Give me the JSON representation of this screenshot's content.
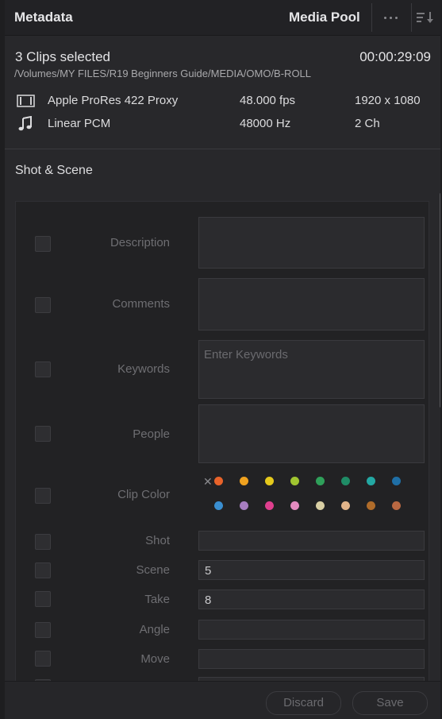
{
  "header": {
    "title": "Metadata",
    "media_pool": "Media Pool"
  },
  "clip_info": {
    "selected": "3 Clips selected",
    "timecode": "00:00:29:09",
    "path": "/Volumes/MY FILES/R19 Beginners Guide/MEDIA/OMO/B-ROLL",
    "video": {
      "codec": "Apple ProRes 422 Proxy",
      "fps": "48.000 fps",
      "resolution": "1920 x 1080"
    },
    "audio": {
      "codec": "Linear PCM",
      "rate": "48000 Hz",
      "channels": "2 Ch"
    }
  },
  "section": {
    "title": "Shot & Scene"
  },
  "fields": {
    "description": {
      "label": "Description",
      "value": ""
    },
    "comments": {
      "label": "Comments",
      "value": ""
    },
    "keywords": {
      "label": "Keywords",
      "placeholder": "Enter Keywords"
    },
    "people": {
      "label": "People",
      "value": ""
    },
    "clip_color": {
      "label": "Clip Color"
    },
    "shot": {
      "label": "Shot",
      "value": ""
    },
    "scene": {
      "label": "Scene",
      "value": "5"
    },
    "take": {
      "label": "Take",
      "value": "8"
    },
    "angle": {
      "label": "Angle",
      "value": ""
    },
    "move": {
      "label": "Move",
      "value": ""
    }
  },
  "clip_colors": [
    "#e8632a",
    "#f0a21f",
    "#e5c91c",
    "#a0c530",
    "#2fa05a",
    "#1f8c66",
    "#23a8a3",
    "#1f6fa6",
    "#3a8fd1",
    "#a77ec0",
    "#df3f8e",
    "#e48bbf",
    "#d9cfa4",
    "#e2b48a",
    "#b06c2a",
    "#b96842"
  ],
  "footer": {
    "discard": "Discard",
    "save": "Save"
  }
}
